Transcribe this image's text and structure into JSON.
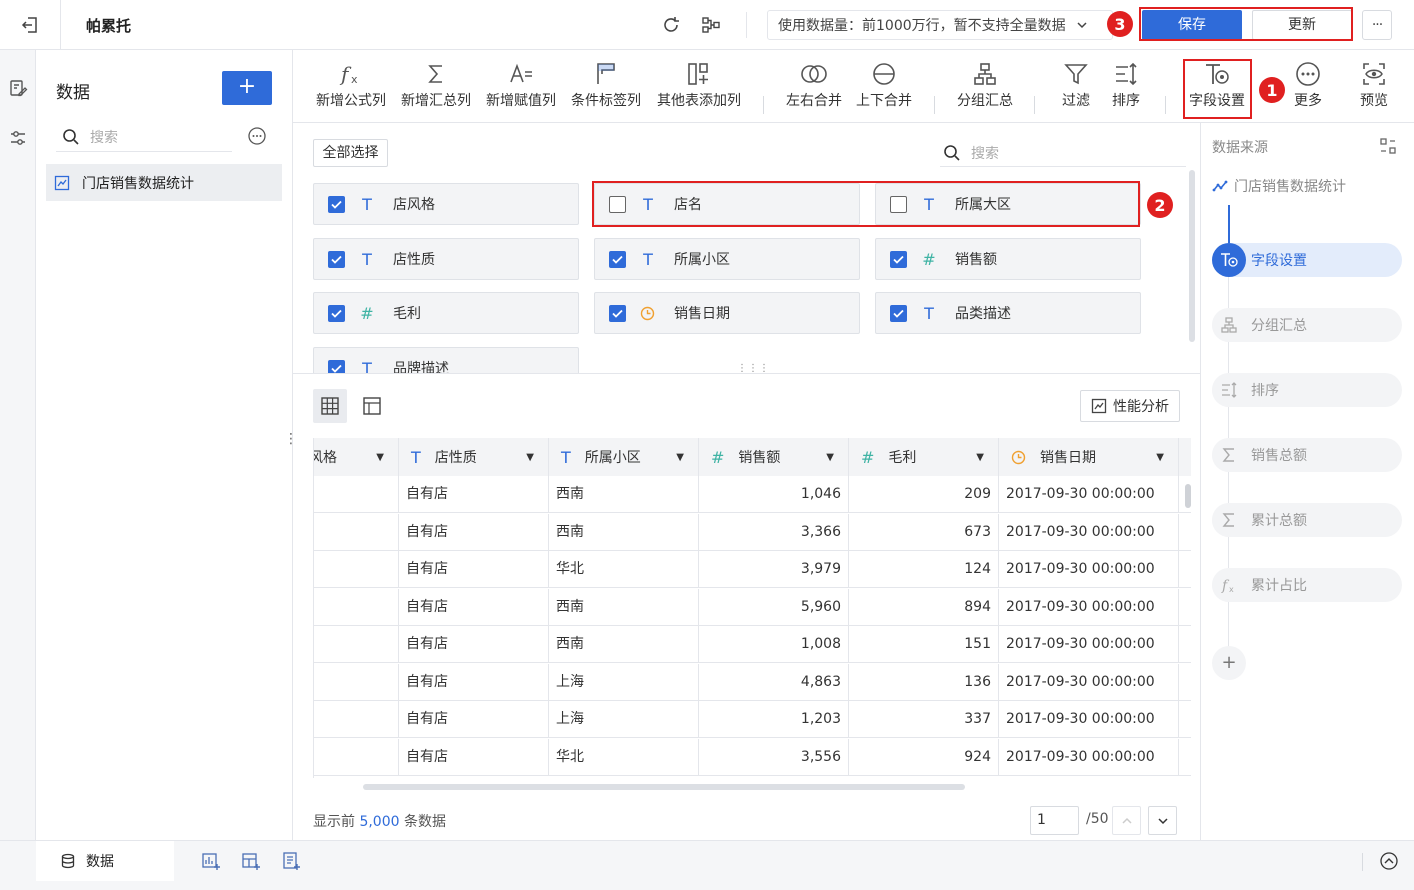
{
  "app": {
    "title": "帕累托"
  },
  "topbar": {
    "data_usage": "使用数据量：前1000万行，暂不支持全量数据",
    "save_label": "保存",
    "update_label": "更新",
    "more_label": "···"
  },
  "sidebar": {
    "title": "数据",
    "add_label": "+",
    "search_placeholder": "搜索",
    "items": [
      {
        "label": "门店销售数据统计"
      }
    ]
  },
  "toolbar": {
    "items": [
      {
        "label": "新增公式列",
        "icon": "formula-icon"
      },
      {
        "label": "新增汇总列",
        "icon": "sigma-icon"
      },
      {
        "label": "新增赋值列",
        "icon": "assign-icon"
      },
      {
        "label": "条件标签列",
        "icon": "flag-icon"
      },
      {
        "label": "其他表添加列",
        "icon": "add-column-icon"
      },
      {
        "label": "左右合并",
        "icon": "merge-lr-icon"
      },
      {
        "label": "上下合并",
        "icon": "merge-tb-icon"
      },
      {
        "label": "分组汇总",
        "icon": "group-icon"
      },
      {
        "label": "过滤",
        "icon": "filter-icon"
      },
      {
        "label": "排序",
        "icon": "sort-icon"
      },
      {
        "label": "字段设置",
        "icon": "field-settings-icon"
      },
      {
        "label": "更多",
        "icon": "more-icon"
      },
      {
        "label": "预览",
        "icon": "preview-icon"
      }
    ]
  },
  "fields": {
    "select_all_label": "全部选择",
    "search_placeholder": "搜索",
    "items": [
      {
        "label": "店风格",
        "type": "text",
        "checked": true
      },
      {
        "label": "店名",
        "type": "text",
        "checked": false
      },
      {
        "label": "所属大区",
        "type": "text",
        "checked": false
      },
      {
        "label": "店性质",
        "type": "text",
        "checked": true
      },
      {
        "label": "所属小区",
        "type": "text",
        "checked": true
      },
      {
        "label": "销售额",
        "type": "number",
        "checked": true
      },
      {
        "label": "毛利",
        "type": "number",
        "checked": true
      },
      {
        "label": "销售日期",
        "type": "date",
        "checked": true
      },
      {
        "label": "品类描述",
        "type": "text",
        "checked": true
      },
      {
        "label": "品牌描述",
        "type": "text",
        "checked": true
      }
    ]
  },
  "preview": {
    "perf_label": "性能分析",
    "columns": [
      {
        "label": "风格",
        "type": "text"
      },
      {
        "label": "店性质",
        "type": "text"
      },
      {
        "label": "所属小区",
        "type": "text"
      },
      {
        "label": "销售额",
        "type": "number"
      },
      {
        "label": "毛利",
        "type": "number"
      },
      {
        "label": "销售日期",
        "type": "date"
      }
    ],
    "rows": [
      [
        "",
        "自有店",
        "西南",
        "1,046",
        "209",
        "2017-09-30 00:00:00"
      ],
      [
        "",
        "自有店",
        "西南",
        "3,366",
        "673",
        "2017-09-30 00:00:00"
      ],
      [
        "",
        "自有店",
        "华北",
        "3,979",
        "124",
        "2017-09-30 00:00:00"
      ],
      [
        "",
        "自有店",
        "西南",
        "5,960",
        "894",
        "2017-09-30 00:00:00"
      ],
      [
        "",
        "自有店",
        "西南",
        "1,008",
        "151",
        "2017-09-30 00:00:00"
      ],
      [
        "",
        "自有店",
        "上海",
        "4,863",
        "136",
        "2017-09-30 00:00:00"
      ],
      [
        "",
        "自有店",
        "上海",
        "1,203",
        "337",
        "2017-09-30 00:00:00"
      ],
      [
        "",
        "自有店",
        "华北",
        "3,556",
        "924",
        "2017-09-30 00:00:00"
      ]
    ],
    "footer_prefix": "显示前",
    "footer_count": "5,000",
    "footer_suffix": "条数据",
    "page_value": "1",
    "page_total": "/50"
  },
  "flow": {
    "title": "数据来源",
    "source": "门店销售数据统计",
    "steps": [
      {
        "label": "字段设置",
        "icon": "field-settings-icon",
        "active": true
      },
      {
        "label": "分组汇总",
        "icon": "group-icon",
        "active": false
      },
      {
        "label": "排序",
        "icon": "sort-icon",
        "active": false
      },
      {
        "label": "销售总额",
        "icon": "sigma-icon",
        "active": false
      },
      {
        "label": "累计总额",
        "icon": "sigma-icon",
        "active": false
      },
      {
        "label": "累计占比",
        "icon": "formula-icon",
        "active": false
      }
    ],
    "add_label": "+"
  },
  "bottom": {
    "tab_label": "数据"
  },
  "annotations": [
    "1",
    "2",
    "3"
  ],
  "colors": {
    "accent": "#2f6bd9",
    "highlight": "#e02020",
    "active_bg": "#e3ecfb"
  }
}
